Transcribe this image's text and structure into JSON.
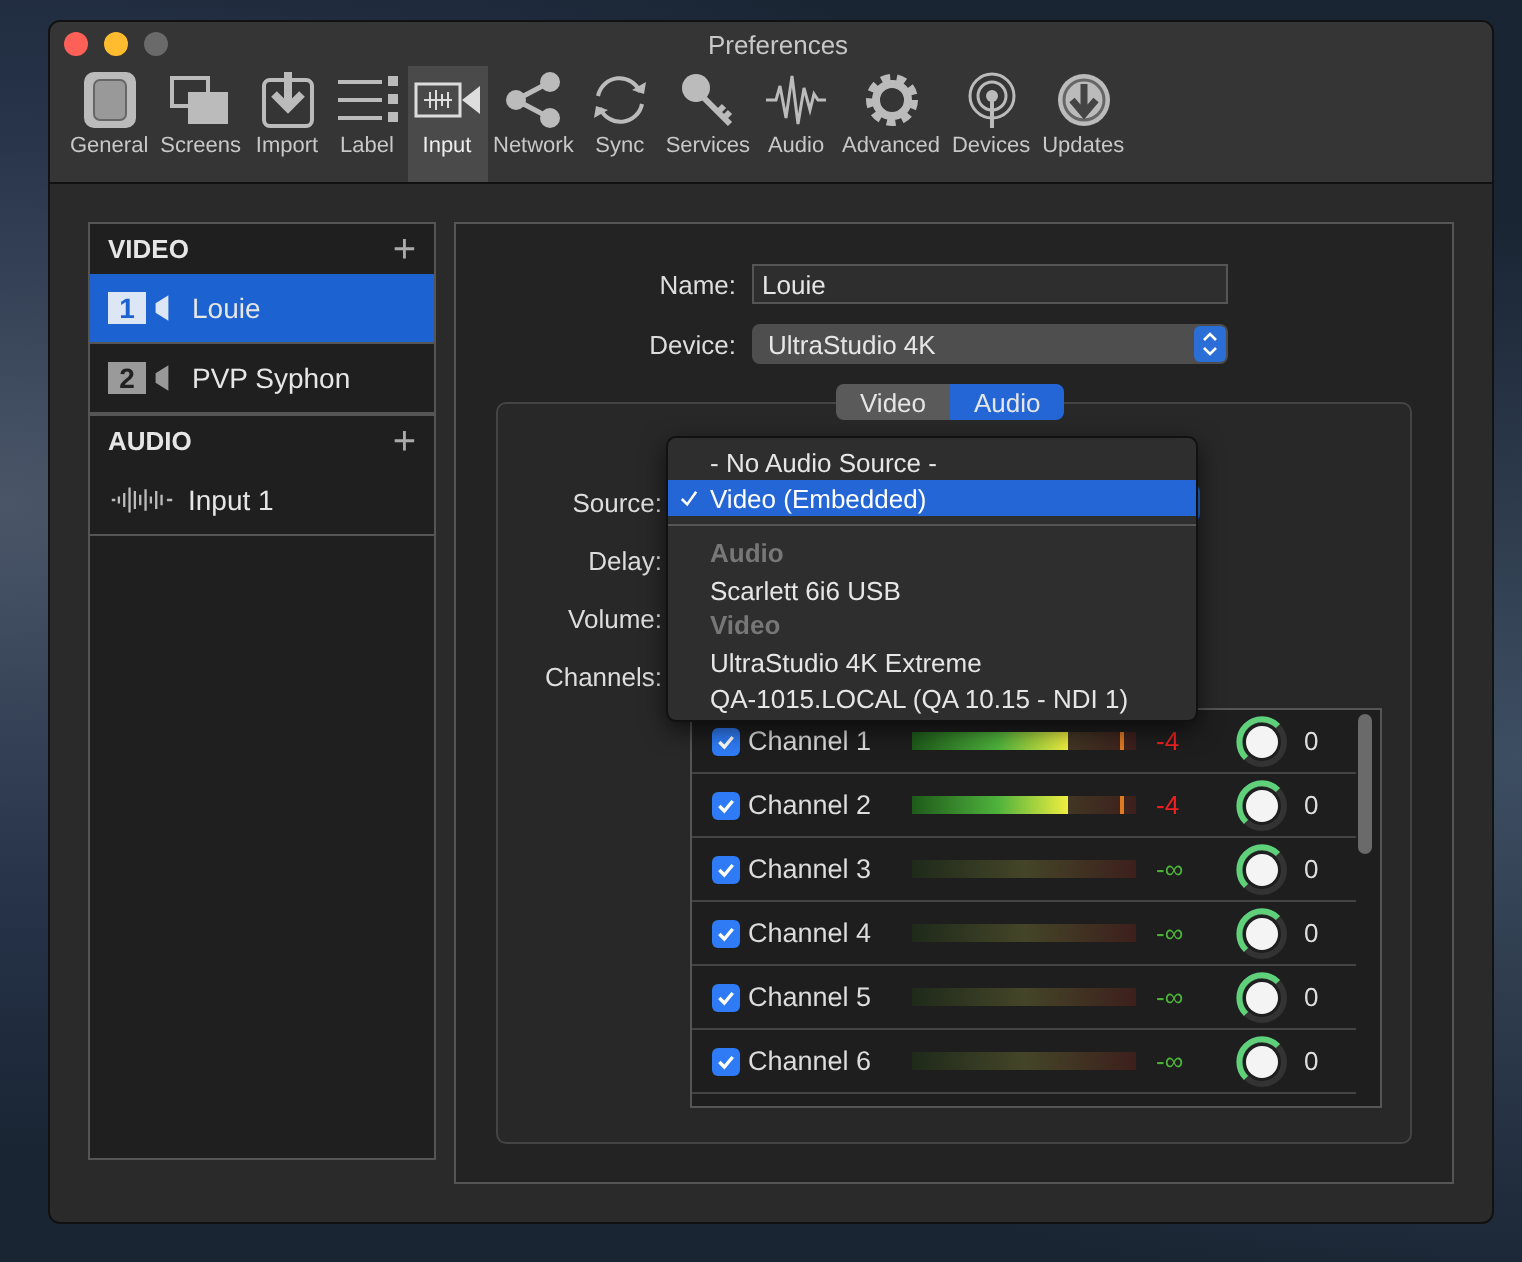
{
  "window": {
    "title": "Preferences"
  },
  "toolbar": [
    {
      "label": "General",
      "selected": false
    },
    {
      "label": "Screens",
      "selected": false
    },
    {
      "label": "Import",
      "selected": false
    },
    {
      "label": "Label",
      "selected": false
    },
    {
      "label": "Input",
      "selected": true
    },
    {
      "label": "Network",
      "selected": false
    },
    {
      "label": "Sync",
      "selected": false
    },
    {
      "label": "Services",
      "selected": false
    },
    {
      "label": "Audio",
      "selected": false
    },
    {
      "label": "Advanced",
      "selected": false
    },
    {
      "label": "Devices",
      "selected": false
    },
    {
      "label": "Updates",
      "selected": false
    }
  ],
  "sidebar": {
    "sections": [
      {
        "title": "VIDEO",
        "add": "+",
        "items": [
          {
            "kind": "video",
            "number": "1",
            "label": "Louie",
            "selected": true
          },
          {
            "kind": "video",
            "number": "2",
            "label": "PVP Syphon",
            "selected": false
          }
        ]
      },
      {
        "title": "AUDIO",
        "add": "+",
        "items": [
          {
            "kind": "audio",
            "label": "Input 1",
            "selected": false
          }
        ]
      }
    ]
  },
  "form": {
    "name_label": "Name:",
    "name_value": "Louie",
    "device_label": "Device:",
    "device_value": "UltraStudio 4K",
    "tabs": [
      {
        "label": "Video",
        "selected": false
      },
      {
        "label": "Audio",
        "selected": true
      }
    ],
    "source_label": "Source:",
    "delay_label": "Delay:",
    "volume_label": "Volume:",
    "channels_label": "Channels:"
  },
  "source_menu": [
    {
      "kind": "item",
      "label": "- No Audio Source -",
      "selected": false
    },
    {
      "kind": "item",
      "label": "Video (Embedded)",
      "selected": true
    },
    {
      "kind": "separator"
    },
    {
      "kind": "header",
      "label": "Audio"
    },
    {
      "kind": "item",
      "label": "Scarlett 6i6 USB",
      "selected": false
    },
    {
      "kind": "header",
      "label": "Video"
    },
    {
      "kind": "item",
      "label": "UltraStudio 4K Extreme",
      "selected": false
    },
    {
      "kind": "item",
      "label": "QA-1015.LOCAL (QA 10.15 - NDI 1)",
      "selected": false
    }
  ],
  "channels": [
    {
      "name": "Channel 1",
      "checked": true,
      "level": 0.7,
      "reading": "-4",
      "clipping": true,
      "value": "0"
    },
    {
      "name": "Channel 2",
      "checked": true,
      "level": 0.7,
      "reading": "-4",
      "clipping": true,
      "value": "0"
    },
    {
      "name": "Channel 3",
      "checked": true,
      "level": 0,
      "reading": "-∞",
      "clipping": false,
      "value": "0"
    },
    {
      "name": "Channel 4",
      "checked": true,
      "level": 0,
      "reading": "-∞",
      "clipping": false,
      "value": "0"
    },
    {
      "name": "Channel 5",
      "checked": true,
      "level": 0,
      "reading": "-∞",
      "clipping": false,
      "value": "0"
    },
    {
      "name": "Channel 6",
      "checked": true,
      "level": 0,
      "reading": "-∞",
      "clipping": false,
      "value": "0"
    }
  ]
}
